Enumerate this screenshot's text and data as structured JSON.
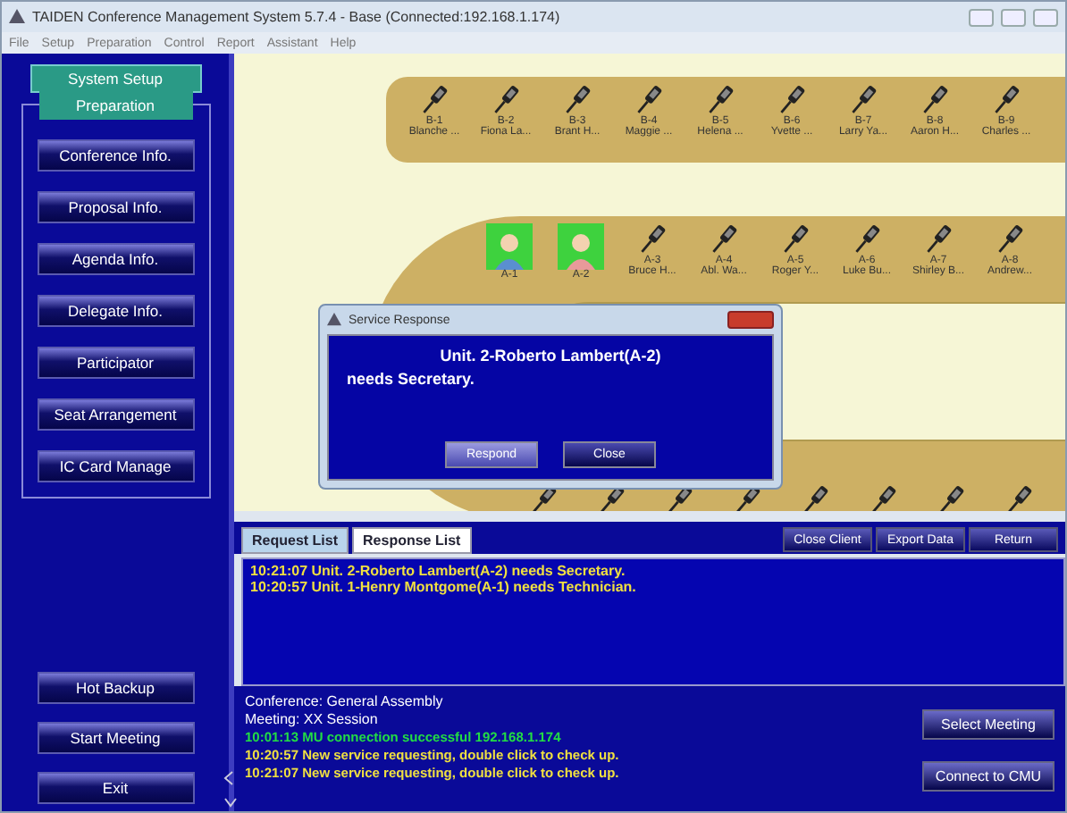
{
  "window": {
    "title": "TAIDEN Conference Management System 5.7.4 - Base (Connected:192.168.1.174)"
  },
  "menu": [
    "File",
    "Setup",
    "Preparation",
    "Control",
    "Report",
    "Assistant",
    "Help"
  ],
  "sidebar": {
    "top_button": "System Setup",
    "group_title": "Preparation",
    "items": [
      "Conference Info.",
      "Proposal Info.",
      "Agenda Info.",
      "Delegate Info.",
      "Participator",
      "Seat Arrangement",
      "IC Card Manage"
    ],
    "bottom_buttons": [
      "Hot Backup",
      "Start Meeting",
      "Exit"
    ]
  },
  "seating": {
    "row_b": [
      {
        "kind": "mic",
        "code": "B-1",
        "name": "Blanche ..."
      },
      {
        "kind": "mic",
        "code": "B-2",
        "name": "Fiona La..."
      },
      {
        "kind": "mic",
        "code": "B-3",
        "name": "Brant H..."
      },
      {
        "kind": "mic",
        "code": "B-4",
        "name": "Maggie ..."
      },
      {
        "kind": "mic",
        "code": "B-5",
        "name": "Helena ..."
      },
      {
        "kind": "mic",
        "code": "B-6",
        "name": "Yvette ..."
      },
      {
        "kind": "mic",
        "code": "B-7",
        "name": "Larry Ya..."
      },
      {
        "kind": "mic",
        "code": "B-8",
        "name": "Aaron H..."
      },
      {
        "kind": "mic",
        "code": "B-9",
        "name": "Charles ..."
      }
    ],
    "row_a": [
      {
        "kind": "person",
        "code": "A-1",
        "color": "#5a8fd0"
      },
      {
        "kind": "person",
        "code": "A-2",
        "color": "#e89a9a"
      },
      {
        "kind": "mic",
        "code": "A-3",
        "name": "Bruce H..."
      },
      {
        "kind": "mic",
        "code": "A-4",
        "name": "Abl. Wa..."
      },
      {
        "kind": "mic",
        "code": "A-5",
        "name": "Roger Y..."
      },
      {
        "kind": "mic",
        "code": "A-6",
        "name": "Luke Bu..."
      },
      {
        "kind": "mic",
        "code": "A-7",
        "name": "Shirley B..."
      },
      {
        "kind": "mic",
        "code": "A-8",
        "name": "Andrew..."
      }
    ]
  },
  "dialog": {
    "title": "Service Response",
    "line_1": "Unit. 2-Roberto Lambert(A-2)",
    "line_2": "needs Secretary.",
    "buttons": [
      {
        "label": "Respond",
        "selected": true
      },
      {
        "label": "Close",
        "selected": false
      }
    ]
  },
  "tabs": [
    {
      "label": "Request List",
      "selected": true
    },
    {
      "label": "Response List",
      "selected": false
    }
  ],
  "actions": [
    "Close Client",
    "Export Data",
    "Return"
  ],
  "requests": [
    "10:21:07  Unit. 2-Roberto Lambert(A-2) needs Secretary.",
    "10:20:57  Unit. 1-Henry Montgome(A-1) needs Technician."
  ],
  "status": {
    "conference": "Conference: General Assembly",
    "meeting": "Meeting: XX Session",
    "messages": [
      {
        "text": "10:01:13 MU connection successful 192.168.1.174",
        "color": "#22dd44"
      },
      {
        "text": "10:20:57 New service requesting, double click to check up.",
        "color": "#f0e040"
      },
      {
        "text": "10:21:07 New service requesting, double click to check up.",
        "color": "#f0e040"
      }
    ],
    "buttons": [
      "Select Meeting",
      "Connect to CMU"
    ]
  }
}
